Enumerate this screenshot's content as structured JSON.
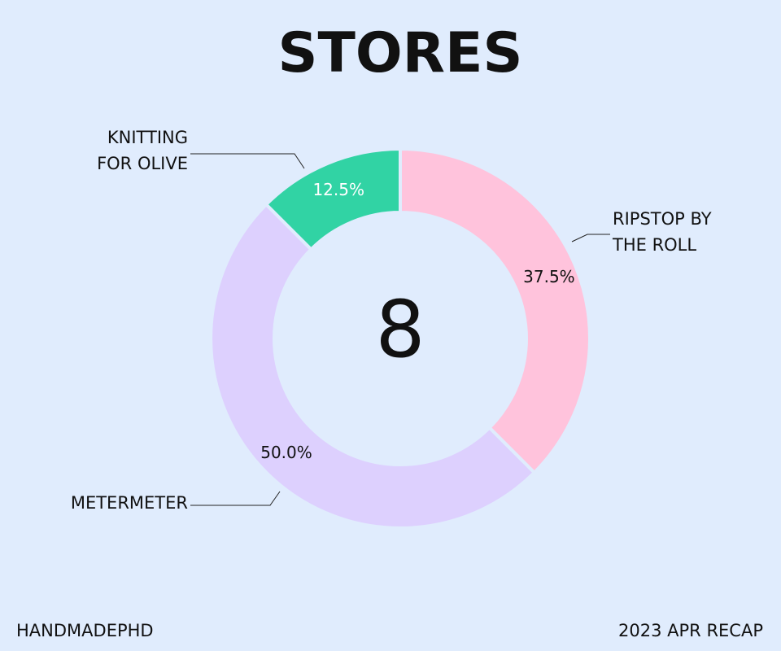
{
  "footer": {
    "left": "HANDMADEPHD",
    "right": "2023 APR RECAP"
  },
  "chart_data": {
    "type": "pie",
    "variant": "donut",
    "title": "STORES",
    "center_value": "8",
    "series": [
      {
        "name": "RIPSTOP BY THE ROLL",
        "label_lines": [
          "RIPSTOP BY",
          "THE ROLL"
        ],
        "value": 37.5,
        "pct_label": "37.5%",
        "color": "#ffc3dc",
        "pct_color": "#111111"
      },
      {
        "name": "METERMETER",
        "label_lines": [
          "METERMETER"
        ],
        "value": 50.0,
        "pct_label": "50.0%",
        "color": "#ddd0fe",
        "pct_color": "#111111"
      },
      {
        "name": "KNITTING FOR OLIVE",
        "label_lines": [
          "KNITTING",
          "FOR OLIVE"
        ],
        "value": 12.5,
        "pct_label": "12.5%",
        "color": "#31d3a4",
        "pct_color": "#ffffff"
      }
    ],
    "start_angle_deg": 0,
    "direction": "clockwise",
    "background": "#e0ecfd"
  }
}
